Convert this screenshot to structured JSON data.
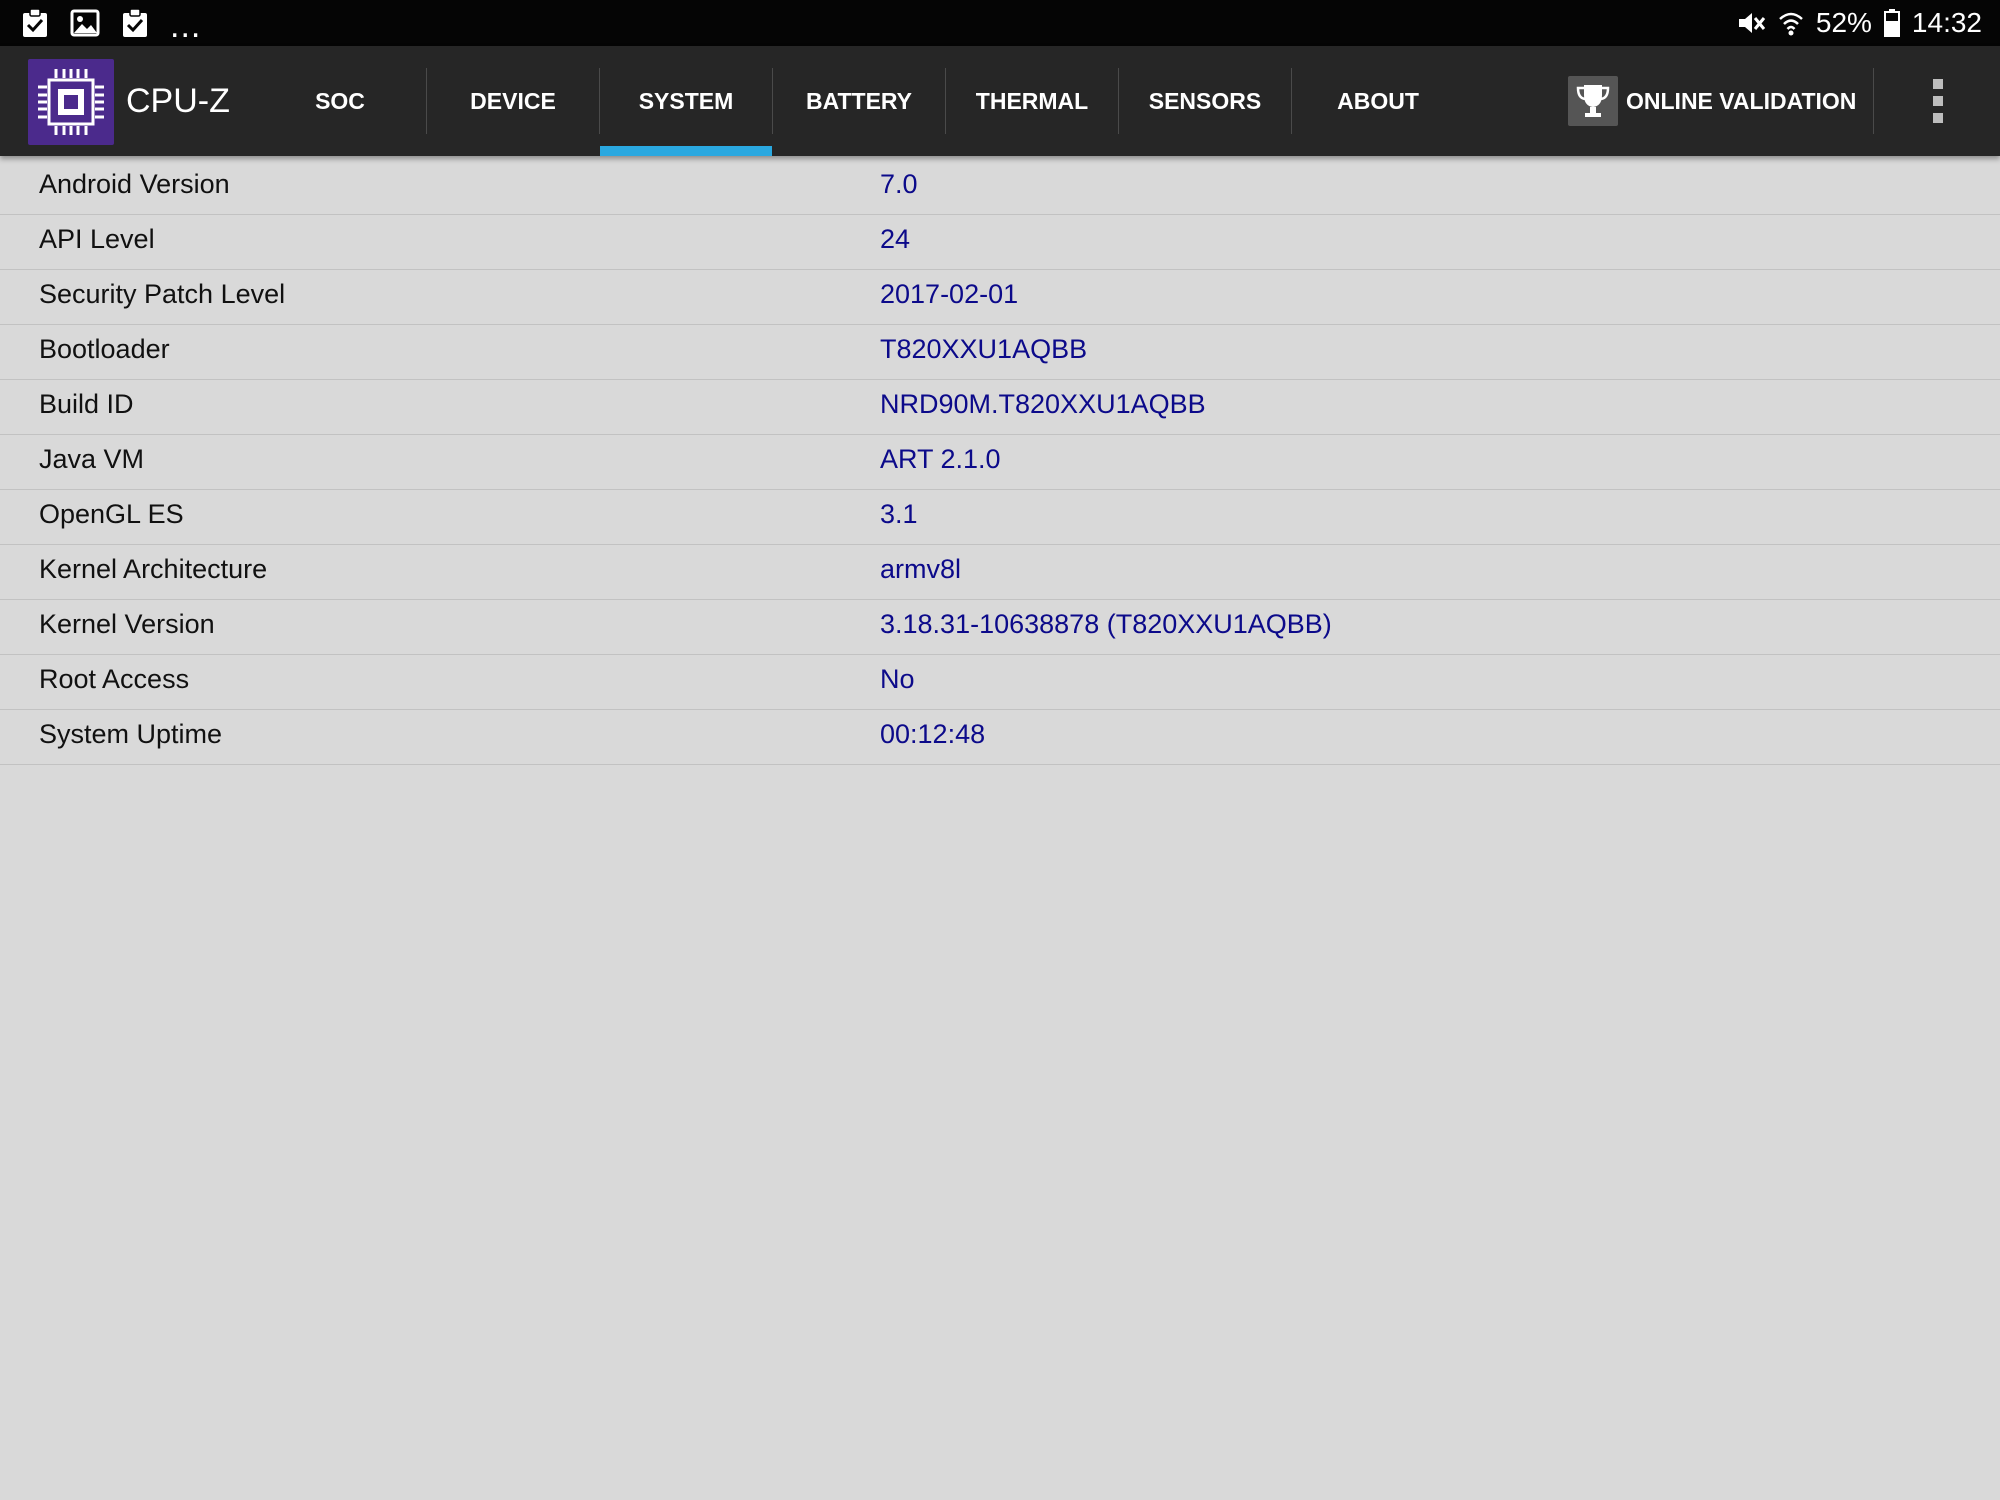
{
  "status_bar": {
    "notification_icons": [
      "clipboard-check-icon",
      "image-icon",
      "clipboard-check-icon"
    ],
    "more_indicator": "...",
    "battery_percent": "52%",
    "time": "14:32"
  },
  "app_bar": {
    "title": "CPU-Z",
    "tabs": [
      {
        "label": "SOC"
      },
      {
        "label": "DEVICE"
      },
      {
        "label": "SYSTEM"
      },
      {
        "label": "BATTERY"
      },
      {
        "label": "THERMAL"
      },
      {
        "label": "SENSORS"
      },
      {
        "label": "ABOUT"
      }
    ],
    "active_tab": "SYSTEM",
    "online_validation_label": "ONLINE VALIDATION",
    "colors": {
      "bar_background": "#262626",
      "active_indicator": "#2aa8e0",
      "logo_background": "#4b2a8c"
    }
  },
  "system_info": {
    "rows": [
      {
        "label": "Android Version",
        "value": "7.0"
      },
      {
        "label": "API Level",
        "value": "24"
      },
      {
        "label": "Security Patch Level",
        "value": "2017-02-01"
      },
      {
        "label": "Bootloader",
        "value": "T820XXU1AQBB"
      },
      {
        "label": "Build ID",
        "value": "NRD90M.T820XXU1AQBB"
      },
      {
        "label": "Java VM",
        "value": "ART 2.1.0"
      },
      {
        "label": "OpenGL ES",
        "value": "3.1"
      },
      {
        "label": "Kernel Architecture",
        "value": "armv8l"
      },
      {
        "label": "Kernel Version",
        "value": "3.18.31-10638878 (T820XXU1AQBB)"
      },
      {
        "label": "Root Access",
        "value": "No"
      },
      {
        "label": "System Uptime",
        "value": "00:12:48"
      }
    ],
    "colors": {
      "label_text": "#111111",
      "value_text": "#0c0a8a",
      "background": "#d9d9d9"
    }
  }
}
